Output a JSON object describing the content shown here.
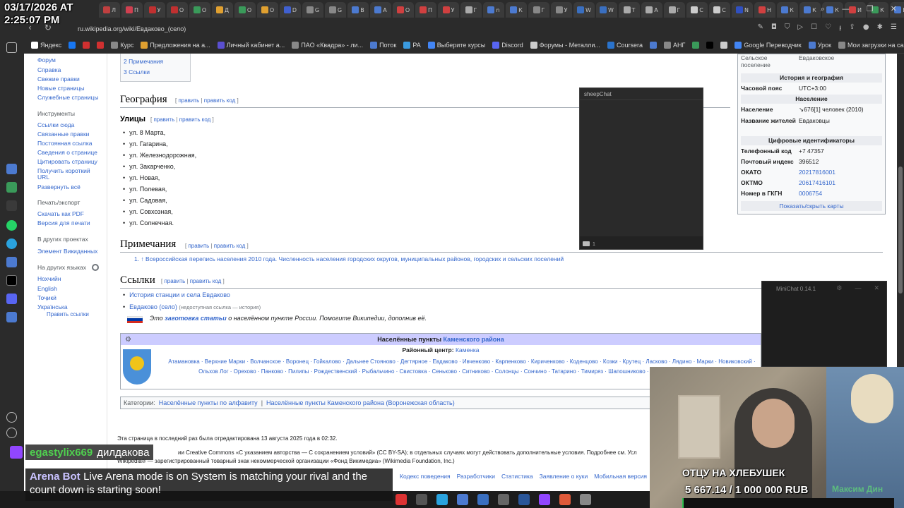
{
  "overlay": {
    "date": "03/17/2026 AT",
    "time": "2:25:07 PM"
  },
  "browser": {
    "url": "ru.wikipedia.org/wiki/Евдаково_(село)",
    "tabs": [
      {
        "label": "Л",
        "color": "#c04040"
      },
      {
        "label": "П",
        "color": "#d04050"
      },
      {
        "label": "У",
        "color": "#c03030"
      },
      {
        "label": "О",
        "color": "#c03030"
      },
      {
        "label": "О",
        "color": "#3a9a5a"
      },
      {
        "label": "Д",
        "color": "#e0a030"
      },
      {
        "label": "О",
        "color": "#3a9a5a"
      },
      {
        "label": "О",
        "color": "#e0a030"
      },
      {
        "label": "D",
        "color": "#4060d0"
      },
      {
        "label": "G",
        "color": "#888888"
      },
      {
        "label": "G",
        "color": "#888888"
      },
      {
        "label": "В",
        "color": "#4c7ad0"
      },
      {
        "label": "А",
        "color": "#4c7ad0"
      },
      {
        "label": "О",
        "color": "#d04040"
      },
      {
        "label": "П",
        "color": "#d04040"
      },
      {
        "label": "У",
        "color": "#d04040"
      },
      {
        "label": "Г",
        "color": "#aaaaaa"
      },
      {
        "label": "n",
        "color": "#4c7ad0"
      },
      {
        "label": "К",
        "color": "#4c7ad0"
      },
      {
        "label": "Г",
        "color": "#888888"
      },
      {
        "label": "У",
        "color": "#888888"
      },
      {
        "label": "W",
        "color": "#3a6fc0"
      },
      {
        "label": "W",
        "color": "#3a6fc0"
      },
      {
        "label": "Т",
        "color": "#aaaaaa"
      },
      {
        "label": "А",
        "color": "#aaaaaa"
      },
      {
        "label": "Г",
        "color": "#aaaaaa"
      },
      {
        "label": "С",
        "color": "#cccccc"
      },
      {
        "label": "С",
        "color": "#cccccc"
      },
      {
        "label": "N",
        "color": "#3050c0"
      },
      {
        "label": "Н",
        "color": "#d04040"
      },
      {
        "label": "К",
        "color": "#4c7ad0"
      },
      {
        "label": "К",
        "color": "#4c7ad0"
      },
      {
        "label": "К",
        "color": "#4c7ad0"
      },
      {
        "label": "И",
        "color": "#d04040"
      },
      {
        "label": "К",
        "color": "#3a9a5a"
      },
      {
        "label": "В",
        "color": "#4c7ad0"
      },
      {
        "label": "Евд",
        "color": "#ffffff"
      }
    ],
    "bookmarks": [
      {
        "label": "Яндекс",
        "color": "#ffffff"
      },
      {
        "label": "",
        "color": "#1877f2"
      },
      {
        "label": "",
        "color": "#d03030"
      },
      {
        "label": "",
        "color": "#d03030"
      },
      {
        "label": "Курс",
        "color": "#888888"
      },
      {
        "label": "Предложения на а...",
        "color": "#e0a030"
      },
      {
        "label": "Личный кабинет а...",
        "color": "#5a4fd0"
      },
      {
        "label": "ПАО «Квадра» - ли...",
        "color": "#888888"
      },
      {
        "label": "Поток",
        "color": "#4c7ad0"
      },
      {
        "label": "РА",
        "color": "#3a9adf"
      },
      {
        "label": "Выберите курсы",
        "color": "#4285f4"
      },
      {
        "label": "Discord",
        "color": "#5865f2"
      },
      {
        "label": "Форумы - Металли...",
        "color": "#cccccc"
      },
      {
        "label": "Coursera",
        "color": "#2a73cc"
      },
      {
        "label": "",
        "color": "#4c7ad0"
      },
      {
        "label": "АНГ",
        "color": "#888888"
      },
      {
        "label": "",
        "color": "#3a9a5a"
      },
      {
        "label": "",
        "color": "#000000"
      },
      {
        "label": "",
        "color": "#cccccc"
      },
      {
        "label": "Google Переводчик",
        "color": "#4285f4"
      },
      {
        "label": "Урок",
        "color": "#4c7ad0"
      },
      {
        "label": "Мои загрузки на са...",
        "color": "#888888"
      }
    ]
  },
  "wiki": {
    "sidebar": {
      "nav": [
        "Форум",
        "Справка",
        "Свежие правки",
        "Новые страницы",
        "Служебные страницы"
      ],
      "tools_head": "Инструменты",
      "tools": [
        "Ссылки сюда",
        "Связанные правки",
        "Постоянная ссылка",
        "Сведения о странице",
        "Цитировать страницу",
        "Получить короткий",
        "URL",
        "Развернуть всё"
      ],
      "print_head": "Печать/экспорт",
      "print": [
        "Скачать как PDF",
        "Версия для печати"
      ],
      "other_head": "В других проектах",
      "other": [
        "Элемент Викиданных"
      ],
      "lang_head": "На других языках",
      "langs": [
        "Нохчийн",
        "English",
        "Тоҷикӣ",
        "Українська"
      ],
      "edit_links": "Править ссылки"
    },
    "toc": [
      "2  Примечания",
      "3  Ссылки"
    ],
    "geo_title": "География",
    "edit_label": "править",
    "edit_code_label": "править код",
    "streets_title": "Улицы",
    "streets": [
      "ул. 8 Марта,",
      "ул. Гагарина,",
      "ул. Железнодорожная,",
      "ул. Закарченко,",
      "ул. Новая,",
      "ул. Полевая,",
      "ул. Садовая,",
      "ул. Совхозная,",
      "ул. Солнечная."
    ],
    "notes_title": "Примечания",
    "note_text": "1. ↑ Всероссийская перепись населения 2010 года. Численность населения городских округов, муниципальных районов, городских и сельских поселений",
    "links_title": "Ссылки",
    "link1": "История станции и села Евдаково",
    "link2": "Евдаково (село)",
    "link2_note": "(недоступная ссылка — история)",
    "stub_prefix": "Это",
    "stub_link": "заготовка статьи",
    "stub_suffix": "о населённом пункте России. Помогите Википедии, дополнив её.",
    "navbox_title": "Населённые пункты",
    "navbox_title_link": "Каменского района",
    "navbox_center_label": "Районный центр:",
    "navbox_center": "Каменка",
    "navbox_items": "Атамановка · Верхние Марки · Волчанское · Воронец · Гойкалово · Дальнее Стояново · Дегтярное · Евдаково · Ивченково · Карпенково · Кириченково · Коденцово · Козки · Крутец · Ласково · Лядино · Марки · Новиковский · Ольхов Лог · Орехово · Панково · Пилипы · Рождественский · Рыбальчино · Свистовка · Сеньково · Ситниково · Солонцы · Сончино · Татарино · Тимиряз · Шапошниково · Щербаково · Ярки · Ясеново",
    "categories_label": "Категории:",
    "categories": [
      "Населённые пункты по алфавиту",
      "Населённые пункты Каменского района (Воронежская область)"
    ],
    "footer_edited": "Эта страница в последний раз была отредактирована 13 августа 2025 года в 02:32.",
    "footer_license": "ии Creative Commons «С указанием авторства — С сохранением условий» (CC BY-SA); в отдельных случаях могут действовать дополнительные условия. Подробнее см. Усл",
    "footer_trademark": "Wikipedia® — зарегистрированный товарный знак некоммерческой организации «Фонд Викимедиа» (Wikimedia Foundation, Inc.)",
    "footer_links": [
      "Кодекс поведения",
      "Разработчики",
      "Статистика",
      "Заявление о куки",
      "Мобильная версия"
    ],
    "infobox": {
      "top_k": "Сельское поселение",
      "top_v": "Евдаковское",
      "sec1": "История и география",
      "tz_k": "Часовой пояс",
      "tz_v": "UTC+3:00",
      "sec2": "Население",
      "pop_k": "Население",
      "pop_v": "↘676[1] человек (2010)",
      "dem_k": "Название жителей",
      "dem_v": "Евдаковцы",
      "sec3": "Цифровые идентификаторы",
      "tel_k": "Телефонный код",
      "tel_v": "+7 47357",
      "post_k": "Почтовый индекс",
      "post_v": "396512",
      "okato_k": "ОКАТО",
      "okato_v": "20217816001",
      "oktmo_k": "ОКТМО",
      "oktmo_v": "20617416101",
      "gkgn_k": "Номер в ГКГН",
      "gkgn_v": "0006754",
      "toggle": "Показать/скрыть карты"
    }
  },
  "sheepchat": {
    "title": "sheepChat",
    "count": "1"
  },
  "minichat": {
    "title": "MiniChat 0.14.1"
  },
  "stream": {
    "caption": "ОТЦУ НА ХЛЕБУШЕК",
    "goal": "5 667.14 / 1 000 000 RUB",
    "goal_fraction": 0.0057,
    "name": "Максим Дин"
  },
  "chat": {
    "user1": "egastylix669",
    "msg1": "дилдакова",
    "user2": "Arena Bot",
    "msg2": "Live Arena mode is on System is matching your rival and the count down is starting soon!"
  }
}
